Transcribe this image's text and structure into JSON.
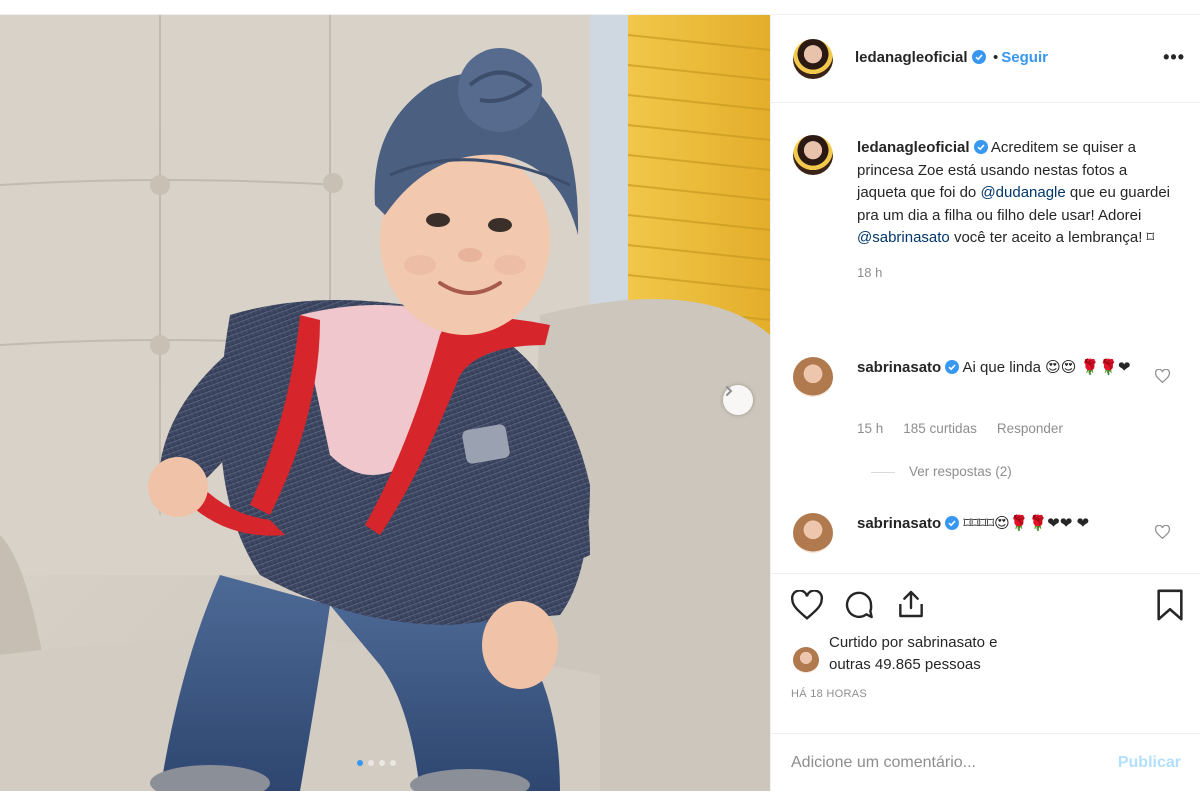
{
  "post": {
    "username": "ledanagleoficial",
    "follow_separator": "•",
    "follow_label": "Seguir",
    "more_label": "•••",
    "carousel": {
      "dot_count": 4,
      "active_dot": 1
    }
  },
  "caption": {
    "username": "ledanagleoficial",
    "part1": " Acreditem se quiser a princesa Zoe está usando nestas fotos a jaqueta que foi do ",
    "mention1": "@dudanagle",
    "part2": " que eu guardei pra um dia a filha ou filho dele usar! Adorei ",
    "mention2": "@sabrinasato",
    "part3": " você ter aceito a lembrança! ⌑",
    "time": "18 h"
  },
  "comments": [
    {
      "username": "sabrinasato",
      "text": " Ai que linda 😍😍 🌹🌹❤",
      "time": "15 h",
      "likes": "185 curtidas",
      "reply_label": "Responder",
      "view_replies": "Ver respostas (2)"
    },
    {
      "username": "sabrinasato",
      "text": " ⌑⌑⌑⌑😍🌹🌹❤❤ ❤"
    }
  ],
  "likes": {
    "prefix": "Curtido por ",
    "user": "sabrinasato",
    "middle": " e",
    "others": "outras 49.865 pessoas"
  },
  "time_ago": "HÁ 18 HORAS",
  "add_comment": {
    "placeholder": "Adicione um comentário...",
    "publish_label": "Publicar"
  },
  "colors": {
    "accent": "#3897f0",
    "mention": "#00376b",
    "muted": "#8e8e8e",
    "publish_disabled": "#b2dffc"
  },
  "icons": [
    "next-arrow-icon",
    "verified-icon",
    "heart-icon",
    "comment-icon",
    "share-icon",
    "bookmark-icon"
  ]
}
